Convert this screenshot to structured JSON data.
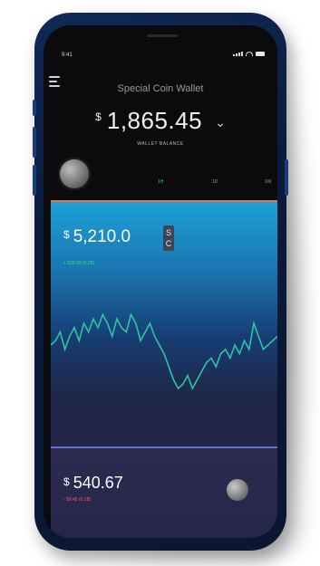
{
  "status": {
    "time": "9:41"
  },
  "header": {
    "title": "Special Coin Wallet",
    "currency_symbol": "$",
    "balance": "1,865.45",
    "balance_label": "WALLET BALANCE"
  },
  "tabs": [
    {
      "label": "1H",
      "active": true
    },
    {
      "label": "1D",
      "active": false
    },
    {
      "label": "1W",
      "active": false
    }
  ],
  "chart_card": {
    "currency_symbol": "$",
    "price": "5,210.0",
    "coin_badge": [
      "S",
      "C"
    ],
    "change": "+ $29.45 (0.26)",
    "accent_color": "#e07a36",
    "line_color": "#2ec4a4"
  },
  "bottom_card": {
    "currency_symbol": "$",
    "price": "540.67",
    "change": "- $9.45 (0.18)",
    "accent_color": "#5b6ee8",
    "change_color": "#ff5a5a"
  },
  "icons": {
    "menu": "menu-icon",
    "chevron": "chevron-down-icon",
    "coin": "coin-icon"
  },
  "chart_data": {
    "type": "line",
    "x": [
      0,
      1,
      2,
      3,
      4,
      5,
      6,
      7,
      8,
      9,
      10,
      11,
      12,
      13,
      14,
      15,
      16,
      17,
      18,
      19,
      20,
      21,
      22,
      23,
      24,
      25,
      26,
      27,
      28,
      29,
      30,
      31,
      32,
      33,
      34,
      35,
      36,
      37,
      38,
      39,
      40,
      41,
      42,
      43,
      44,
      45,
      46,
      47,
      48
    ],
    "values": [
      60,
      62,
      66,
      58,
      64,
      68,
      62,
      70,
      66,
      72,
      68,
      74,
      70,
      64,
      72,
      68,
      66,
      74,
      70,
      62,
      66,
      70,
      64,
      60,
      56,
      50,
      44,
      40,
      42,
      46,
      40,
      44,
      48,
      52,
      54,
      50,
      56,
      58,
      54,
      60,
      56,
      62,
      58,
      70,
      64,
      58,
      60,
      62,
      64
    ],
    "title": "",
    "xlabel": "",
    "ylabel": ""
  }
}
